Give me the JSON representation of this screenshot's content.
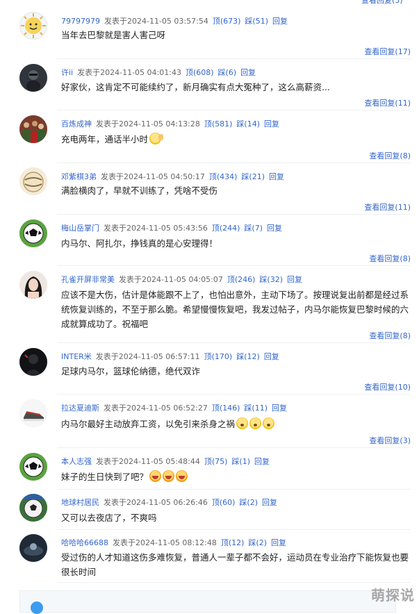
{
  "top_link": "查看回复(3)",
  "watermark": "萌探说",
  "comments": [
    {
      "user": "79797979",
      "posted": "发表于2024-11-05 03:57:54",
      "up": "顶(673)",
      "down": "踩(51)",
      "reply": "回复",
      "text": "当年去巴黎就是害人害己呀",
      "more": "查看回复(17)",
      "avatar": "sun-face"
    },
    {
      "user": "许ii",
      "posted": "发表于2024-11-05 04:01:43",
      "up": "顶(608)",
      "down": "踩(6)",
      "reply": "回复",
      "text": "好家伙，这肯定不可能续约了，新月确实有点大冤种了，这么高薪资...",
      "more": "查看回复(11)",
      "avatar": "dark-person"
    },
    {
      "user": "百炼成神",
      "posted": "发表于2024-11-05 04:13:28",
      "up": "顶(581)",
      "down": "踩(14)",
      "reply": "回复",
      "text": "充电两年，通话半小时",
      "emoji": "wave",
      "more": "查看回复(8)",
      "avatar": "crowd"
    },
    {
      "user": "邓紫棋3弟",
      "posted": "发表于2024-11-05 04:50:17",
      "up": "顶(434)",
      "down": "踩(21)",
      "reply": "回复",
      "text": "满脸横肉了，早就不训练了，凭啥不受伤",
      "more": "查看回复(11)",
      "avatar": "ball-cream"
    },
    {
      "user": "梅山岳掌门",
      "posted": "发表于2024-11-05 05:43:56",
      "up": "顶(244)",
      "down": "踩(7)",
      "reply": "回复",
      "text": "内马尔、阿扎尔，挣钱真的是心安理得！",
      "more": "查看回复(8)",
      "avatar": "soccer-ball"
    },
    {
      "user": "孔雀开屏非常美",
      "posted": "发表于2024-11-05 04:05:07",
      "up": "顶(246)",
      "down": "踩(32)",
      "reply": "回复",
      "text": "应该不是大伤，估计是体能跟不上了，也怕出意外，主动下场了。按理说复出前都是经过系统恢复训练的，不至于那么脆。希望慢慢恢复吧，我发过帖子，内马尔能恢复巴黎时候的六成就算成功了。祝福吧",
      "more": "查看回复(8)",
      "avatar": "woman"
    },
    {
      "user": "INTER米",
      "posted": "发表于2024-11-05 06:57:11",
      "up": "顶(170)",
      "down": "踩(12)",
      "reply": "回复",
      "text": "足球内马尔，篮球伦纳德，绝代双诈",
      "more": "查看回复(10)",
      "avatar": "dark-figure"
    },
    {
      "user": "拉达夏迪斯",
      "posted": "发表于2024-11-05 06:52:27",
      "up": "顶(146)",
      "down": "踩(11)",
      "reply": "回复",
      "text": "内马尔最好主动放弃工资，以免引来杀身之祸",
      "emoji": "cry3",
      "more": "查看回复(3)",
      "avatar": "sneaker"
    },
    {
      "user": "本人志强",
      "posted": "发表于2024-11-05 05:48:44",
      "up": "顶(75)",
      "down": "踩(1)",
      "reply": "回复",
      "text": "妹子的生日快到了吧？",
      "emoji": "laugh3",
      "more": "",
      "avatar": "soccer-ball"
    },
    {
      "user": "地球村居民",
      "posted": "发表于2024-11-05 06:26:46",
      "up": "顶(60)",
      "down": "踩(2)",
      "reply": "回复",
      "text": "又可以去夜店了，不爽吗",
      "more": "",
      "avatar": "soccer-ball-2"
    },
    {
      "user": "哈哈哈66688",
      "posted": "发表于2024-11-05 08:12:48",
      "up": "顶(12)",
      "down": "踩(2)",
      "reply": "回复",
      "text": "受过伤的人才知道这伤多难恢复，普通人一辈子都不会好，运动员在专业治疗下能恢复也要很长时间",
      "more": "",
      "avatar": "dark-scene"
    }
  ]
}
